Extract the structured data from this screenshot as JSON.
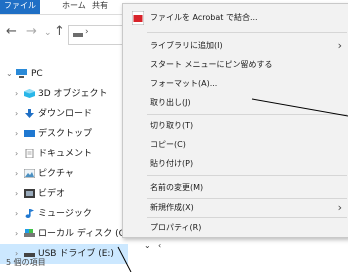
{
  "ribbon": {
    "tabs": [
      "ファイル",
      "ホーム",
      "共有"
    ]
  },
  "nav": {
    "back_icon": "←",
    "forward_icon": "→",
    "expand_icon": "⌄",
    "up_icon": "↑"
  },
  "tree": {
    "items": [
      {
        "label": "PC",
        "icon": "pc-icon",
        "chevron": "⌄"
      },
      {
        "label": "3D オブジェクト",
        "icon": "cube-icon",
        "chevron": "›"
      },
      {
        "label": "ダウンロード",
        "icon": "download-icon",
        "chevron": "›"
      },
      {
        "label": "デスクトップ",
        "icon": "desktop-icon",
        "chevron": "›"
      },
      {
        "label": "ドキュメント",
        "icon": "document-icon",
        "chevron": "›"
      },
      {
        "label": "ピクチャ",
        "icon": "pictures-icon",
        "chevron": "›"
      },
      {
        "label": "ビデオ",
        "icon": "video-icon",
        "chevron": "›"
      },
      {
        "label": "ミュージック",
        "icon": "music-icon",
        "chevron": "›"
      },
      {
        "label": "ローカル ディスク (C",
        "icon": "drive-icon",
        "chevron": "›"
      },
      {
        "label": "USB ドライブ (E:)",
        "icon": "usb-drive-icon",
        "chevron": "›",
        "selected": true
      }
    ]
  },
  "status": {
    "item_count": "5 個の項目"
  },
  "context_menu": {
    "items": [
      {
        "label": "ファイルを Acrobat で結合...",
        "icon": "acrobat-icon"
      },
      {
        "label": "ライブラリに追加(I)",
        "submenu": true
      },
      {
        "label": "スタート メニューにピン留めする"
      },
      {
        "label": "フォーマット(A)..."
      },
      {
        "label": "取り出し(J)"
      },
      {
        "label": "切り取り(T)"
      },
      {
        "label": "コピー(C)"
      },
      {
        "label": "貼り付け(P)"
      },
      {
        "label": "名前の変更(M)"
      },
      {
        "label": "新規作成(X)",
        "submenu": true
      },
      {
        "label": "プロパティ(R)"
      }
    ],
    "submenu_arrow": "›"
  },
  "scroll": {
    "down_glyph": "⌄",
    "left_glyph": "‹"
  },
  "colors": {
    "accent": "#1f6fc5",
    "selection": "#cce8ff",
    "menu_bg": "#f2f2f2"
  }
}
